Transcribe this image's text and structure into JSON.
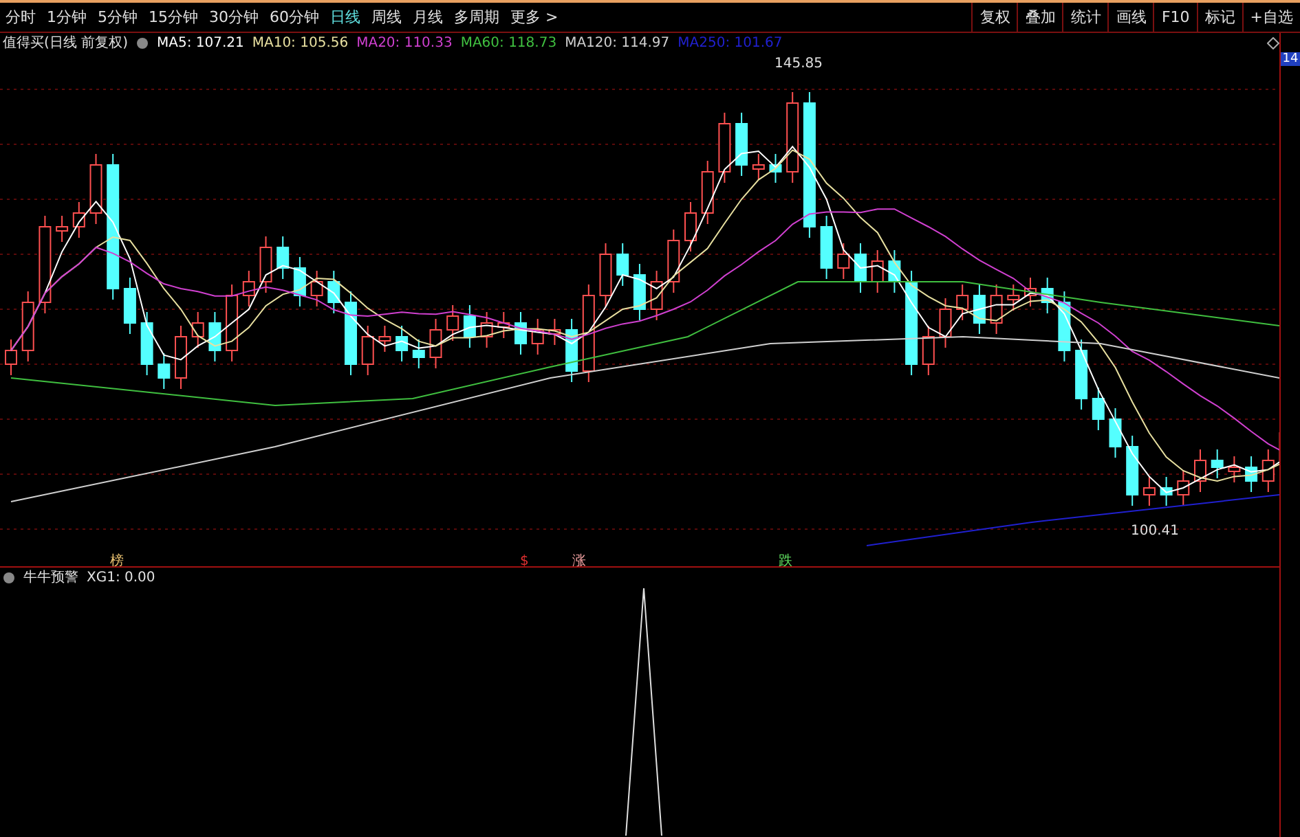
{
  "toolbar": {
    "periods": [
      {
        "label": "分时",
        "selected": false
      },
      {
        "label": "1分钟",
        "selected": false
      },
      {
        "label": "5分钟",
        "selected": false
      },
      {
        "label": "15分钟",
        "selected": false
      },
      {
        "label": "30分钟",
        "selected": false
      },
      {
        "label": "60分钟",
        "selected": false
      },
      {
        "label": "日线",
        "selected": true
      },
      {
        "label": "周线",
        "selected": false
      },
      {
        "label": "月线",
        "selected": false
      },
      {
        "label": "多周期",
        "selected": false
      },
      {
        "label": "更多 >",
        "selected": false
      }
    ],
    "actions": [
      "复权",
      "叠加",
      "统计",
      "画线",
      "F10",
      "标记",
      "+自选"
    ]
  },
  "price_panel": {
    "title": "值得买(日线 前复权)",
    "averages": [
      {
        "label": "MA5: 107.21",
        "color": "#ffffff"
      },
      {
        "label": "MA10: 105.56",
        "color": "#e8e0a0"
      },
      {
        "label": "MA20: 110.33",
        "color": "#d040d0"
      },
      {
        "label": "MA60: 118.73",
        "color": "#40c040"
      },
      {
        "label": "MA120: 114.97",
        "color": "#d0d0d0"
      },
      {
        "label": "MA250: 101.67",
        "color": "#2020d0"
      }
    ],
    "high_marker": "145.85",
    "low_marker": "100.41",
    "signals": [
      {
        "text": "榜",
        "color": "#e8c070"
      },
      {
        "text": "$",
        "color": "#e03030"
      },
      {
        "text": "涨",
        "color": "#f0a0a0"
      },
      {
        "text": "跌",
        "color": "#60e060"
      }
    ],
    "price_tag": "14"
  },
  "indicator_panel": {
    "title": "牛牛预警",
    "reading": "XG1: 0.00"
  }
}
